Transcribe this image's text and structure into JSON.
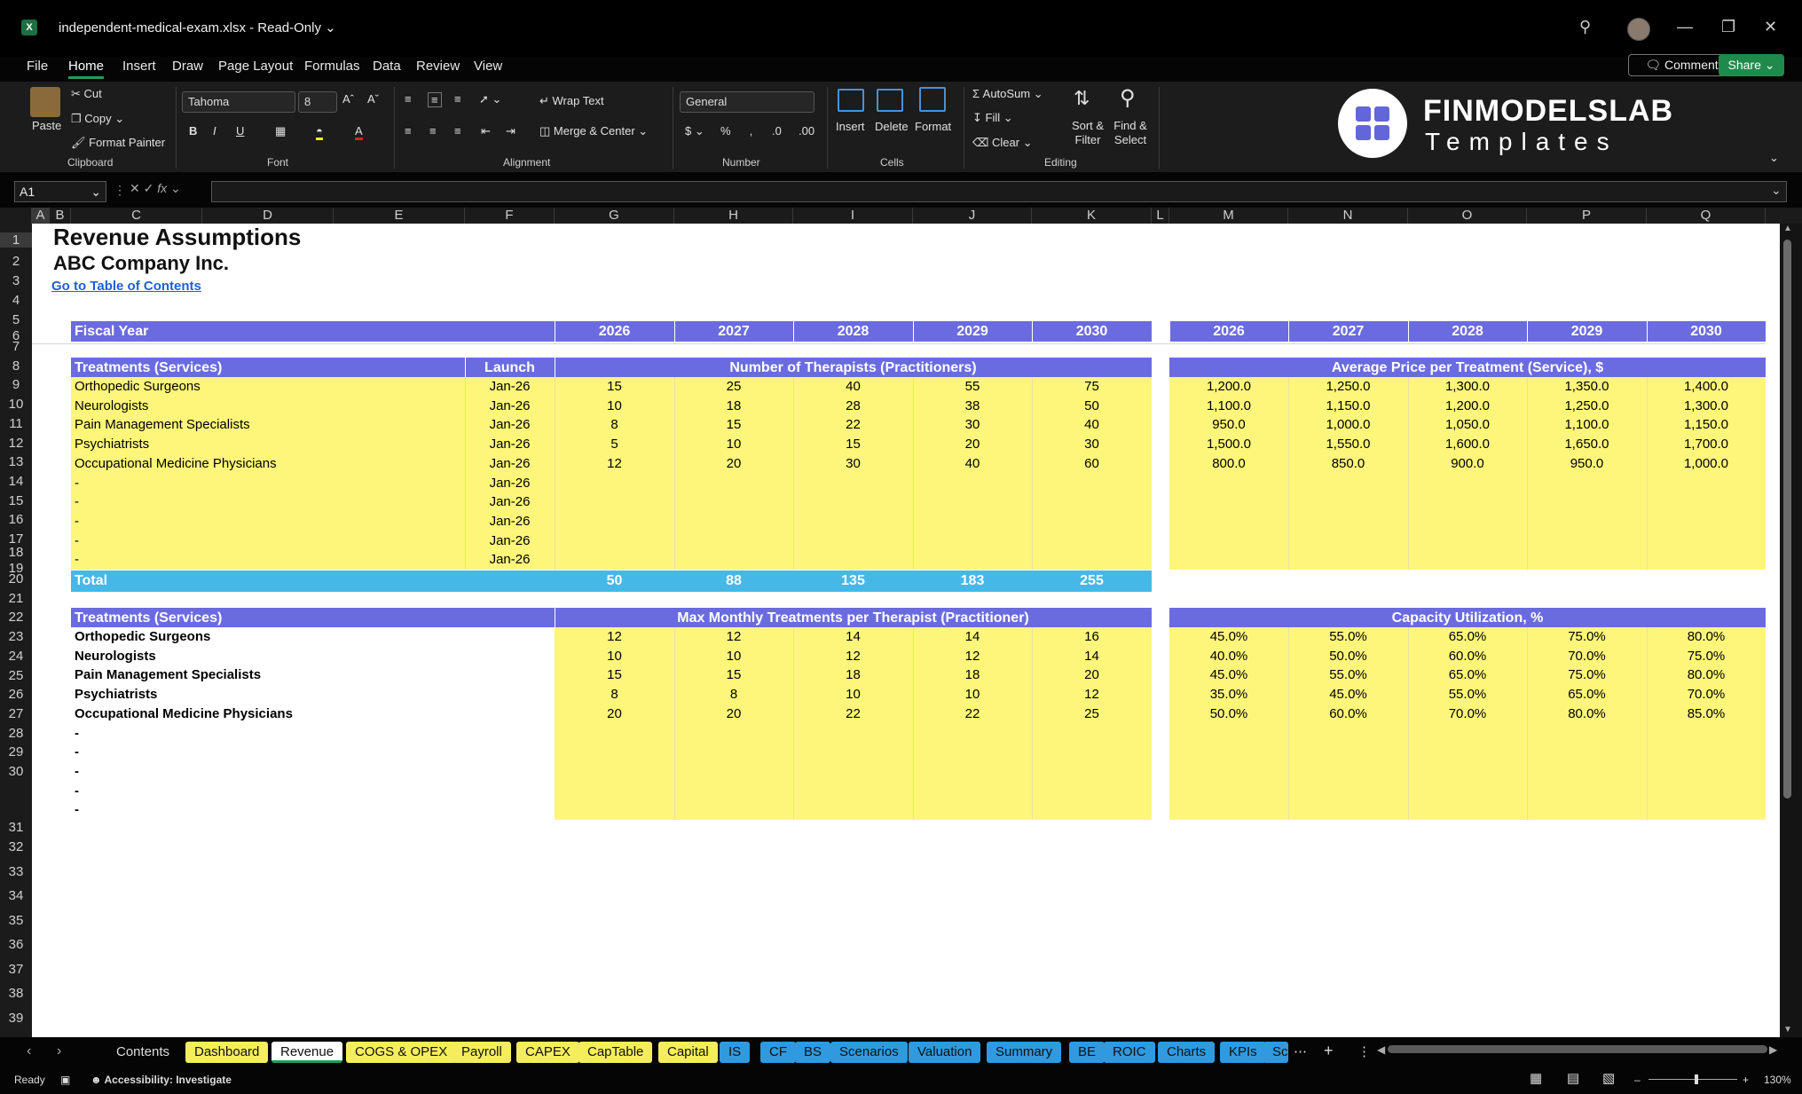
{
  "window": {
    "title": "independent-medical-exam.xlsx  ·  Read-Only",
    "file_name": "independent-medical-exam.xlsx",
    "mode": "Read-Only"
  },
  "menu": [
    "File",
    "Home",
    "Insert",
    "Draw",
    "Page Layout",
    "Formulas",
    "Data",
    "Review",
    "View"
  ],
  "header_buttons": {
    "comments": "Comments",
    "share": "Share"
  },
  "ribbon": {
    "clipboard": {
      "paste": "Paste",
      "cut": "Cut",
      "copy": "Copy",
      "format_painter": "Format Painter",
      "group": "Clipboard"
    },
    "font": {
      "name": "Tahoma",
      "size": "8",
      "group": "Font"
    },
    "alignment": {
      "wrap_text": "Wrap Text",
      "merge_center": "Merge & Center",
      "group": "Alignment"
    },
    "number": {
      "format": "General",
      "group": "Number"
    },
    "cells": {
      "insert": "Insert",
      "delete": "Delete",
      "format": "Format",
      "group": "Cells"
    },
    "editing": {
      "autosum": "AutoSum",
      "fill": "Fill",
      "clear": "Clear",
      "sort_filter": "Sort & Filter",
      "find_select": "Find & Select",
      "group": "Editing"
    }
  },
  "brand": {
    "name": "FINMODELSLAB",
    "sub": "Templates"
  },
  "formula_bar": {
    "name_box": "A1",
    "fx": "fx",
    "content": ""
  },
  "columns": [
    "A",
    "B",
    "C",
    "D",
    "E",
    "F",
    "G",
    "H",
    "I",
    "J",
    "K",
    "L",
    "M",
    "N",
    "O",
    "P",
    "Q"
  ],
  "rows": [
    "1",
    "2",
    "3",
    "4",
    "5",
    "6",
    "7",
    "8",
    "9",
    "10",
    "11",
    "12",
    "13",
    "14",
    "15",
    "16",
    "17",
    "18",
    "19",
    "20",
    "21",
    "22",
    "23",
    "24",
    "25",
    "26",
    "27",
    "28",
    "29",
    "30",
    "31",
    "32",
    "33",
    "34",
    "35",
    "36",
    "37",
    "38",
    "39"
  ],
  "sheet": {
    "title": "Revenue Assumptions",
    "company": "ABC Company Inc.",
    "toc_link": "Go to Table of Contents",
    "fiscal_year_label": "Fiscal Year",
    "years": [
      "2026",
      "2027",
      "2028",
      "2029",
      "2030"
    ],
    "years_right": [
      "2026",
      "2027",
      "2028",
      "2029",
      "2030"
    ],
    "section1": {
      "label": "Treatments (Services)",
      "launch_label": "Launch",
      "mid_header": "Number of Therapists (Practitioners)",
      "right_header": "Average Price per Treatment (Service), $",
      "rows": [
        {
          "name": "Orthopedic Surgeons",
          "launch": "Jan-26",
          "vals": [
            "15",
            "25",
            "40",
            "55",
            "75"
          ],
          "price": [
            "1,200.0",
            "1,250.0",
            "1,300.0",
            "1,350.0",
            "1,400.0"
          ]
        },
        {
          "name": "Neurologists",
          "launch": "Jan-26",
          "vals": [
            "10",
            "18",
            "28",
            "38",
            "50"
          ],
          "price": [
            "1,100.0",
            "1,150.0",
            "1,200.0",
            "1,250.0",
            "1,300.0"
          ]
        },
        {
          "name": "Pain Management Specialists",
          "launch": "Jan-26",
          "vals": [
            "8",
            "15",
            "22",
            "30",
            "40"
          ],
          "price": [
            "950.0",
            "1,000.0",
            "1,050.0",
            "1,100.0",
            "1,150.0"
          ]
        },
        {
          "name": "Psychiatrists",
          "launch": "Jan-26",
          "vals": [
            "5",
            "10",
            "15",
            "20",
            "30"
          ],
          "price": [
            "1,500.0",
            "1,550.0",
            "1,600.0",
            "1,650.0",
            "1,700.0"
          ]
        },
        {
          "name": "Occupational Medicine Physicians",
          "launch": "Jan-26",
          "vals": [
            "12",
            "20",
            "30",
            "40",
            "60"
          ],
          "price": [
            "800.0",
            "850.0",
            "900.0",
            "950.0",
            "1,000.0"
          ]
        },
        {
          "name": "-",
          "launch": "Jan-26",
          "vals": [
            "",
            "",
            "",
            "",
            ""
          ],
          "price": [
            "",
            "",
            "",
            "",
            ""
          ]
        },
        {
          "name": "-",
          "launch": "Jan-26",
          "vals": [
            "",
            "",
            "",
            "",
            ""
          ],
          "price": [
            "",
            "",
            "",
            "",
            ""
          ]
        },
        {
          "name": "-",
          "launch": "Jan-26",
          "vals": [
            "",
            "",
            "",
            "",
            ""
          ],
          "price": [
            "",
            "",
            "",
            "",
            ""
          ]
        },
        {
          "name": "-",
          "launch": "Jan-26",
          "vals": [
            "",
            "",
            "",
            "",
            ""
          ],
          "price": [
            "",
            "",
            "",
            "",
            ""
          ]
        },
        {
          "name": "-",
          "launch": "Jan-26",
          "vals": [
            "",
            "",
            "",
            "",
            ""
          ],
          "price": [
            "",
            "",
            "",
            "",
            ""
          ]
        }
      ],
      "total_label": "Total",
      "totals": [
        "50",
        "88",
        "135",
        "183",
        "255"
      ]
    },
    "section2": {
      "label": "Treatments (Services)",
      "mid_header": "Max Monthly Treatments per Therapist (Practitioner)",
      "right_header": "Capacity Utilization, %",
      "rows": [
        {
          "name": "Orthopedic Surgeons",
          "vals": [
            "12",
            "12",
            "14",
            "14",
            "16"
          ],
          "util": [
            "45.0%",
            "55.0%",
            "65.0%",
            "75.0%",
            "80.0%"
          ]
        },
        {
          "name": "Neurologists",
          "vals": [
            "10",
            "10",
            "12",
            "12",
            "14"
          ],
          "util": [
            "40.0%",
            "50.0%",
            "60.0%",
            "70.0%",
            "75.0%"
          ]
        },
        {
          "name": "Pain Management Specialists",
          "vals": [
            "15",
            "15",
            "18",
            "18",
            "20"
          ],
          "util": [
            "45.0%",
            "55.0%",
            "65.0%",
            "75.0%",
            "80.0%"
          ]
        },
        {
          "name": "Psychiatrists",
          "vals": [
            "8",
            "8",
            "10",
            "10",
            "12"
          ],
          "util": [
            "35.0%",
            "45.0%",
            "55.0%",
            "65.0%",
            "70.0%"
          ]
        },
        {
          "name": "Occupational Medicine Physicians",
          "vals": [
            "20",
            "20",
            "22",
            "22",
            "25"
          ],
          "util": [
            "50.0%",
            "60.0%",
            "70.0%",
            "80.0%",
            "85.0%"
          ]
        },
        {
          "name": "-",
          "vals": [
            "",
            "",
            "",
            "",
            ""
          ],
          "util": [
            "",
            "",
            "",
            "",
            ""
          ]
        },
        {
          "name": "-",
          "vals": [
            "",
            "",
            "",
            "",
            ""
          ],
          "util": [
            "",
            "",
            "",
            "",
            ""
          ]
        },
        {
          "name": "-",
          "vals": [
            "",
            "",
            "",
            "",
            ""
          ],
          "util": [
            "",
            "",
            "",
            "",
            ""
          ]
        },
        {
          "name": "-",
          "vals": [
            "",
            "",
            "",
            "",
            ""
          ],
          "util": [
            "",
            "",
            "",
            "",
            ""
          ]
        },
        {
          "name": "-",
          "vals": [
            "",
            "",
            "",
            "",
            ""
          ],
          "util": [
            "",
            "",
            "",
            "",
            ""
          ]
        }
      ]
    }
  },
  "tabs": [
    {
      "label": "Contents",
      "style": "plain"
    },
    {
      "label": "Dashboard",
      "style": "yellow"
    },
    {
      "label": "Revenue",
      "style": "active"
    },
    {
      "label": "COGS & OPEX",
      "style": "yellow"
    },
    {
      "label": "Payroll",
      "style": "yellow"
    },
    {
      "label": "CAPEX",
      "style": "yellow"
    },
    {
      "label": "CapTable",
      "style": "yellow"
    },
    {
      "label": "Capital",
      "style": "yellow"
    },
    {
      "label": "IS",
      "style": "blue"
    },
    {
      "label": "CF",
      "style": "blue"
    },
    {
      "label": "BS",
      "style": "blue"
    },
    {
      "label": "Scenarios",
      "style": "blue"
    },
    {
      "label": "Valuation",
      "style": "blue"
    },
    {
      "label": "Summary",
      "style": "blue"
    },
    {
      "label": "BE",
      "style": "blue"
    },
    {
      "label": "ROIC",
      "style": "blue"
    },
    {
      "label": "Charts",
      "style": "blue"
    },
    {
      "label": "KPIs",
      "style": "blue"
    },
    {
      "label": "Sc",
      "style": "blue"
    }
  ],
  "status": {
    "ready": "Ready",
    "accessibility": "Accessibility: Investigate",
    "zoom": "130%"
  },
  "colors": {
    "header_blue": "#6b6be0",
    "input_yellow": "#fdf67a",
    "total_cyan": "#45b8e8",
    "excel_green": "#1f9e5a"
  }
}
